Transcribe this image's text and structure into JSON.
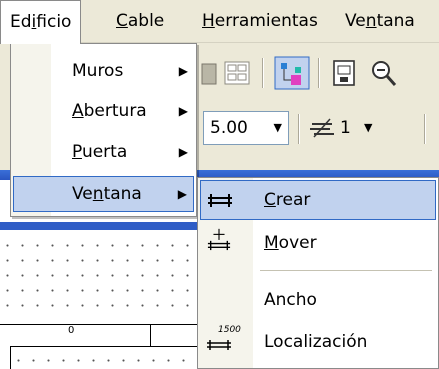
{
  "menubar": {
    "items": [
      {
        "label_pre": "Ed",
        "label_u": "i",
        "label_post": "ficio"
      },
      {
        "label_pre": "",
        "label_u": "C",
        "label_post": "able"
      },
      {
        "label_pre": "",
        "label_u": "H",
        "label_post": "erramientas"
      },
      {
        "label_pre": "Ve",
        "label_u": "n",
        "label_post": "tana"
      }
    ]
  },
  "toolbar": {
    "scale_value": "5.00",
    "layer_value": "1"
  },
  "menu1": {
    "items": [
      {
        "label_pre": "Muros",
        "label_u": "",
        "label_post": ""
      },
      {
        "label_pre": "",
        "label_u": "A",
        "label_post": "bertura"
      },
      {
        "label_pre": "",
        "label_u": "P",
        "label_post": "uerta"
      },
      {
        "label_pre": "Ve",
        "label_u": "n",
        "label_post": "tana"
      }
    ],
    "submenu_arrow": "▶"
  },
  "menu2": {
    "items": [
      {
        "label_pre": "",
        "label_u": "C",
        "label_post": "rear"
      },
      {
        "label_pre": "",
        "label_u": "M",
        "label_post": "over"
      },
      {
        "label_pre": "Ancho",
        "label_u": "",
        "label_post": ""
      },
      {
        "label_pre": "Localización",
        "label_u": "",
        "label_post": ""
      }
    ],
    "localizacion_icon_text": "1500"
  },
  "drawing": {
    "ruler_zero": "0"
  },
  "icons": {
    "toolbar": [
      "grid-icon",
      "layer-tree-icon",
      "save-view-icon",
      "zoom-icon"
    ],
    "window-symbol": "window-create-icon",
    "window-move": "window-move-icon",
    "window-locate": "window-locate-icon"
  }
}
